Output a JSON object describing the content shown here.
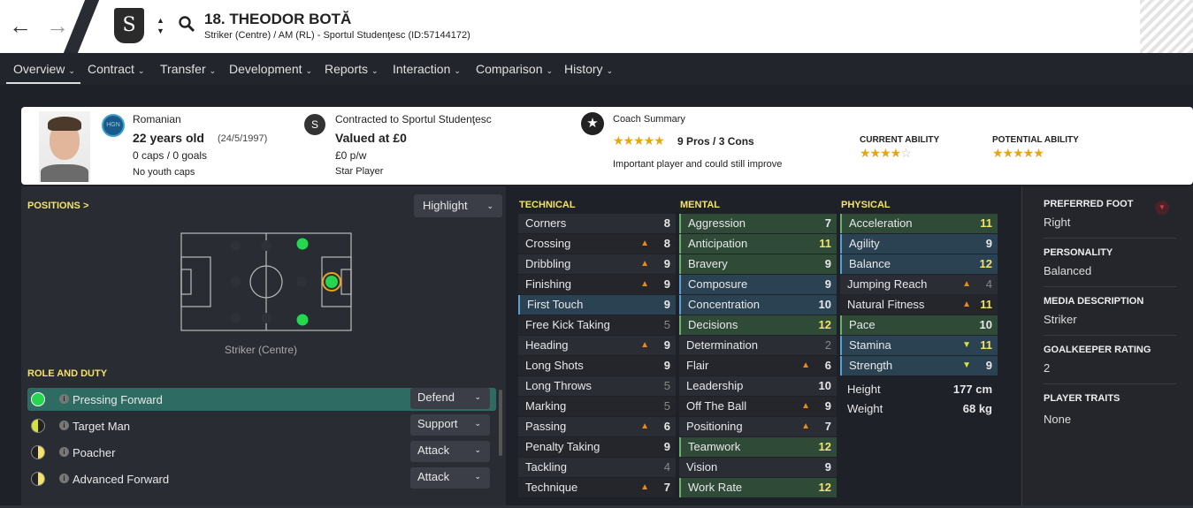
{
  "header": {
    "player_name": "18. THEODOR BOTĂ",
    "player_sub": "Striker (Centre) / AM (RL) - Sportul Studenţesc (ID:57144172)"
  },
  "menu": [
    {
      "label": "Overview"
    },
    {
      "label": "Contract"
    },
    {
      "label": "Transfer"
    },
    {
      "label": "Development"
    },
    {
      "label": "Reports"
    },
    {
      "label": "Interaction"
    },
    {
      "label": "Comparison"
    },
    {
      "label": "History"
    }
  ],
  "info": {
    "nationality": "Romanian",
    "nation_code": "HGN",
    "age": "22 years old",
    "dob": "(24/5/1997)",
    "caps": "0 caps / 0 goals",
    "youth_caps": "No youth caps",
    "contract": "Contracted to Sportul Studenţesc",
    "value": "Valued at £0",
    "wage": "£0 p/w",
    "status": "Star Player",
    "coach_title": "Coach Summary",
    "pros_cons": "9 Pros / 3 Cons",
    "coach_note": "Important player and could still improve",
    "coach_stars": 4.5,
    "current_ability_label": "CURRENT ABILITY",
    "current_ability_stars": 3.5,
    "potential_ability_label": "POTENTIAL ABILITY",
    "potential_ability_stars": 5
  },
  "positions": {
    "header": "POSITIONS >",
    "highlight_label": "Highlight",
    "position_label": "Striker (Centre)"
  },
  "roles": {
    "header": "ROLE AND DUTY",
    "items": [
      {
        "name": "Pressing Forward",
        "duty": "Defend"
      },
      {
        "name": "Target Man",
        "duty": "Support"
      },
      {
        "name": "Poacher",
        "duty": "Attack"
      },
      {
        "name": "Advanced Forward",
        "duty": "Attack"
      }
    ]
  },
  "technical": {
    "header": "TECHNICAL",
    "attrs": [
      {
        "name": "Corners",
        "value": "8"
      },
      {
        "name": "Crossing",
        "value": "8"
      },
      {
        "name": "Dribbling",
        "value": "9"
      },
      {
        "name": "Finishing",
        "value": "9"
      },
      {
        "name": "First Touch",
        "value": "9"
      },
      {
        "name": "Free Kick Taking",
        "value": "5"
      },
      {
        "name": "Heading",
        "value": "9"
      },
      {
        "name": "Long Shots",
        "value": "9"
      },
      {
        "name": "Long Throws",
        "value": "5"
      },
      {
        "name": "Marking",
        "value": "5"
      },
      {
        "name": "Passing",
        "value": "6"
      },
      {
        "name": "Penalty Taking",
        "value": "9"
      },
      {
        "name": "Tackling",
        "value": "4"
      },
      {
        "name": "Technique",
        "value": "7"
      }
    ]
  },
  "mental": {
    "header": "MENTAL",
    "attrs": [
      {
        "name": "Aggression",
        "value": "7"
      },
      {
        "name": "Anticipation",
        "value": "11"
      },
      {
        "name": "Bravery",
        "value": "9"
      },
      {
        "name": "Composure",
        "value": "9"
      },
      {
        "name": "Concentration",
        "value": "10"
      },
      {
        "name": "Decisions",
        "value": "12"
      },
      {
        "name": "Determination",
        "value": "2"
      },
      {
        "name": "Flair",
        "value": "6"
      },
      {
        "name": "Leadership",
        "value": "10"
      },
      {
        "name": "Off The Ball",
        "value": "9"
      },
      {
        "name": "Positioning",
        "value": "7"
      },
      {
        "name": "Teamwork",
        "value": "12"
      },
      {
        "name": "Vision",
        "value": "9"
      },
      {
        "name": "Work Rate",
        "value": "12"
      }
    ]
  },
  "physical": {
    "header": "PHYSICAL",
    "attrs": [
      {
        "name": "Acceleration",
        "value": "11"
      },
      {
        "name": "Agility",
        "value": "9"
      },
      {
        "name": "Balance",
        "value": "12"
      },
      {
        "name": "Jumping Reach",
        "value": "4"
      },
      {
        "name": "Natural Fitness",
        "value": "11"
      },
      {
        "name": "Pace",
        "value": "10"
      },
      {
        "name": "Stamina",
        "value": "11"
      },
      {
        "name": "Strength",
        "value": "9"
      }
    ],
    "height_label": "Height",
    "height": "177 cm",
    "weight_label": "Weight",
    "weight": "68 kg"
  },
  "side": {
    "foot_label": "PREFERRED FOOT",
    "foot": "Right",
    "personality_label": "PERSONALITY",
    "personality": "Balanced",
    "media_label": "MEDIA DESCRIPTION",
    "media": "Striker",
    "gk_label": "GOALKEEPER RATING",
    "gk": "2",
    "traits_label": "PLAYER TRAITS",
    "traits": "None"
  },
  "colors": {
    "accent_yellow": "#f3e36b",
    "role_selected": "#2e6c63",
    "star": "#e8a60e"
  }
}
